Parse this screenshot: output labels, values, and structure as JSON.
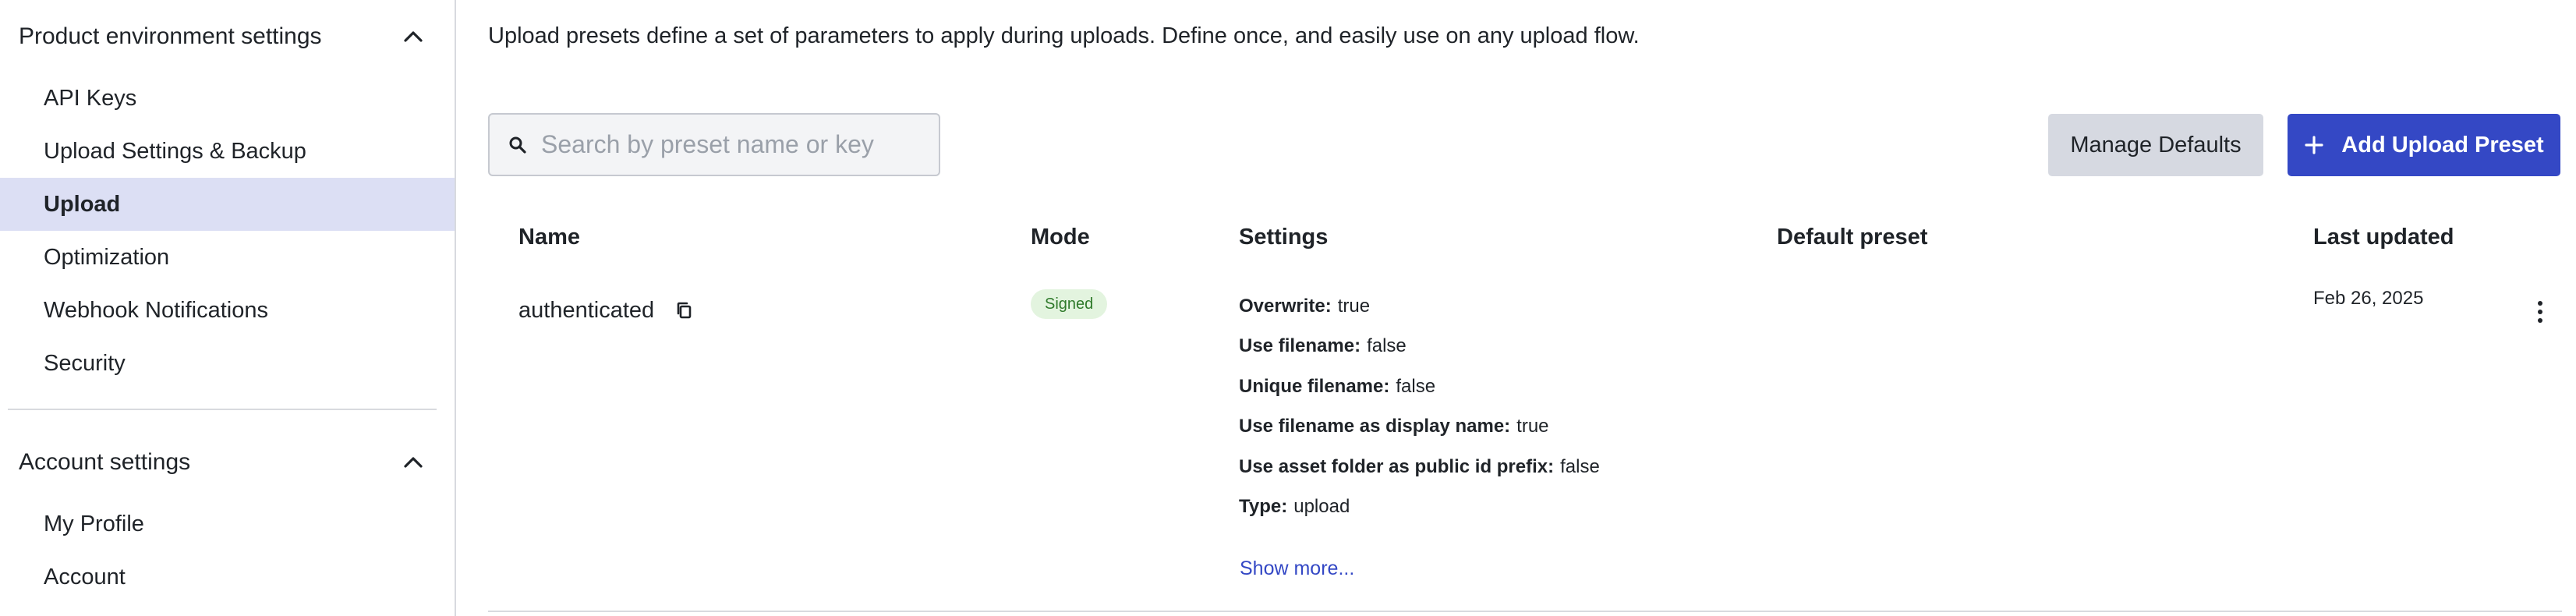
{
  "sidebar": {
    "sections": [
      {
        "title": "Product environment settings",
        "items": [
          {
            "label": "API Keys"
          },
          {
            "label": "Upload Settings & Backup"
          },
          {
            "label": "Upload"
          },
          {
            "label": "Optimization"
          },
          {
            "label": "Webhook Notifications"
          },
          {
            "label": "Security"
          }
        ],
        "active_item": "Upload"
      },
      {
        "title": "Account settings",
        "items": [
          {
            "label": "My Profile"
          },
          {
            "label": "Account"
          }
        ]
      }
    ]
  },
  "main": {
    "intro": "Upload presets define a set of parameters to apply during uploads. Define once, and easily use on any upload flow.",
    "search": {
      "placeholder": "Search by preset name or key",
      "value": ""
    },
    "buttons": {
      "manage_defaults": "Manage Defaults",
      "add_preset": "Add Upload Preset"
    },
    "table": {
      "headers": {
        "name": "Name",
        "mode": "Mode",
        "settings": "Settings",
        "default_preset": "Default preset",
        "last_updated": "Last updated"
      },
      "rows": [
        {
          "name": "authenticated",
          "mode": "Signed",
          "settings": [
            {
              "key": "Overwrite:",
              "value": "true"
            },
            {
              "key": "Use filename:",
              "value": "false"
            },
            {
              "key": "Unique filename:",
              "value": "false"
            },
            {
              "key": "Use filename as display name:",
              "value": "true"
            },
            {
              "key": "Use asset folder as public id prefix:",
              "value": "false"
            },
            {
              "key": "Type:",
              "value": "upload"
            }
          ],
          "show_more": "Show more...",
          "default_preset": "",
          "last_updated": "Feb 26, 2025"
        }
      ]
    }
  },
  "icons": {
    "section_toggle": "chevron-up-icon",
    "search": "search-icon",
    "add": "plus-icon",
    "copy": "copy-icon",
    "row_menu": "more-vertical-icon"
  },
  "colors": {
    "accent": "#3448c5",
    "active_nav_bg": "#dcdff4",
    "badge_bg": "#e3f4df",
    "badge_text": "#2f7a2b",
    "secondary_button": "#d6d9e1"
  }
}
